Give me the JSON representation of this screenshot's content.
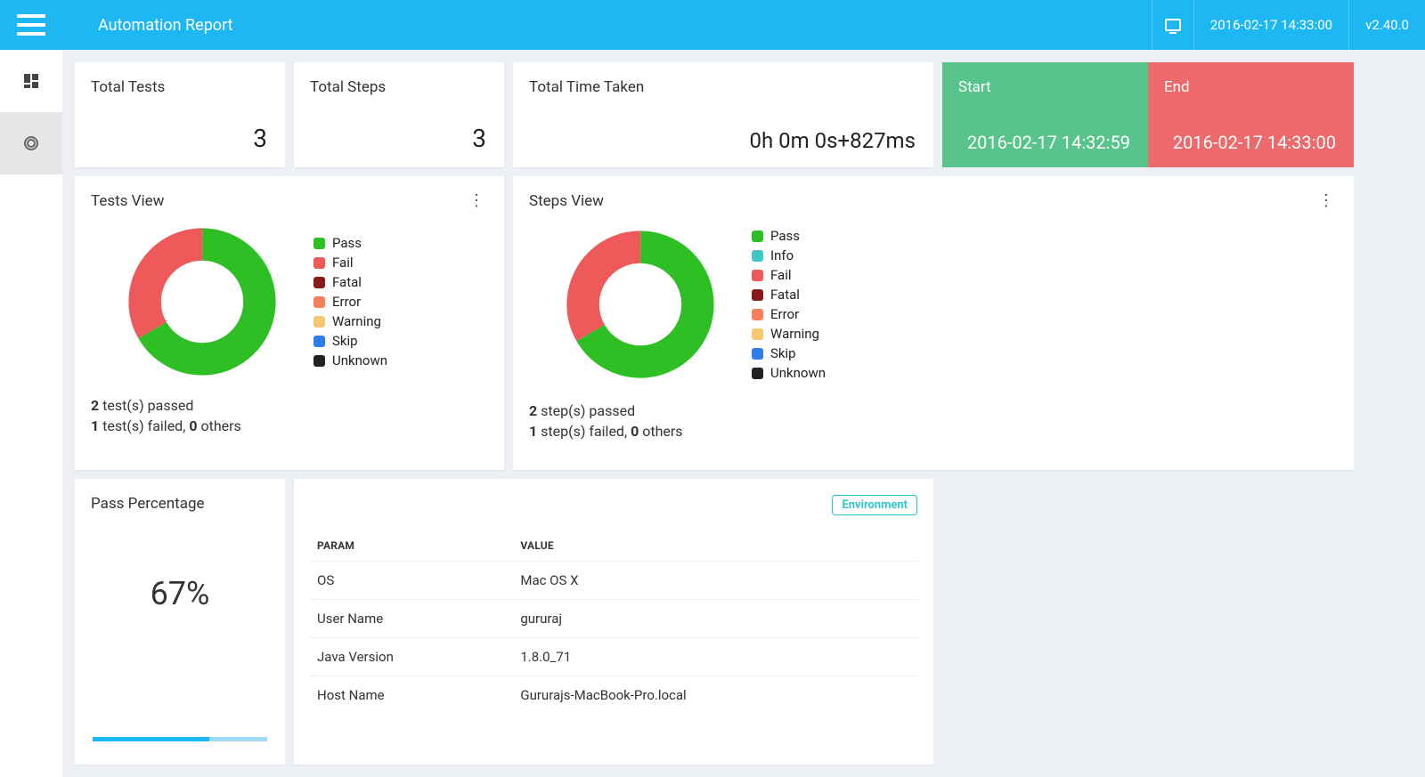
{
  "header": {
    "title": "Automation Report",
    "timestamp": "2016-02-17 14:33:00",
    "version": "v2.40.0"
  },
  "stats": {
    "total_tests_label": "Total Tests",
    "total_tests_value": "3",
    "total_steps_label": "Total Steps",
    "total_steps_value": "3",
    "total_time_label": "Total Time Taken",
    "total_time_value": "0h 0m 0s+827ms"
  },
  "run": {
    "start_label": "Start",
    "start_value": "2016-02-17 14:32:59",
    "end_label": "End",
    "end_value": "2016-02-17 14:33:00"
  },
  "tests_view": {
    "title": "Tests View",
    "legend": [
      {
        "label": "Pass",
        "color": "#2dbf24"
      },
      {
        "label": "Fail",
        "color": "#ee5a5a"
      },
      {
        "label": "Fatal",
        "color": "#8a1a1a"
      },
      {
        "label": "Error",
        "color": "#f77f5a"
      },
      {
        "label": "Warning",
        "color": "#f5c76e"
      },
      {
        "label": "Skip",
        "color": "#2e7de9"
      },
      {
        "label": "Unknown",
        "color": "#222"
      }
    ],
    "summary_pass_n": "2",
    "summary_pass_txt": " test(s) passed",
    "summary_fail_n": "1",
    "summary_fail_txt": " test(s) failed, ",
    "summary_other_n": "0",
    "summary_other_txt": " others"
  },
  "steps_view": {
    "title": "Steps View",
    "legend": [
      {
        "label": "Pass",
        "color": "#2dbf24"
      },
      {
        "label": "Info",
        "color": "#3fc7c3"
      },
      {
        "label": "Fail",
        "color": "#ee5a5a"
      },
      {
        "label": "Fatal",
        "color": "#8a1a1a"
      },
      {
        "label": "Error",
        "color": "#f77f5a"
      },
      {
        "label": "Warning",
        "color": "#f5c76e"
      },
      {
        "label": "Skip",
        "color": "#2e7de9"
      },
      {
        "label": "Unknown",
        "color": "#222"
      }
    ],
    "summary_pass_n": "2",
    "summary_pass_txt": " step(s) passed",
    "summary_fail_n": "1",
    "summary_fail_txt": " step(s) failed, ",
    "summary_other_n": "0",
    "summary_other_txt": " others"
  },
  "pass": {
    "title": "Pass Percentage",
    "value": "67%",
    "percent": 67
  },
  "env": {
    "badge": "Environment",
    "head_param": "PARAM",
    "head_value": "VALUE",
    "rows": [
      {
        "param": "OS",
        "value": "Mac OS X"
      },
      {
        "param": "User Name",
        "value": "gururaj"
      },
      {
        "param": "Java Version",
        "value": "1.8.0_71"
      },
      {
        "param": "Host Name",
        "value": "Gururajs-MacBook-Pro.local"
      }
    ]
  },
  "chart_data": [
    {
      "type": "pie",
      "title": "Tests View",
      "series": [
        {
          "name": "tests",
          "values": [
            2,
            1,
            0,
            0,
            0,
            0,
            0
          ]
        }
      ],
      "categories": [
        "Pass",
        "Fail",
        "Fatal",
        "Error",
        "Warning",
        "Skip",
        "Unknown"
      ]
    },
    {
      "type": "pie",
      "title": "Steps View",
      "series": [
        {
          "name": "steps",
          "values": [
            2,
            0,
            1,
            0,
            0,
            0,
            0,
            0
          ]
        }
      ],
      "categories": [
        "Pass",
        "Info",
        "Fail",
        "Fatal",
        "Error",
        "Warning",
        "Skip",
        "Unknown"
      ]
    }
  ]
}
